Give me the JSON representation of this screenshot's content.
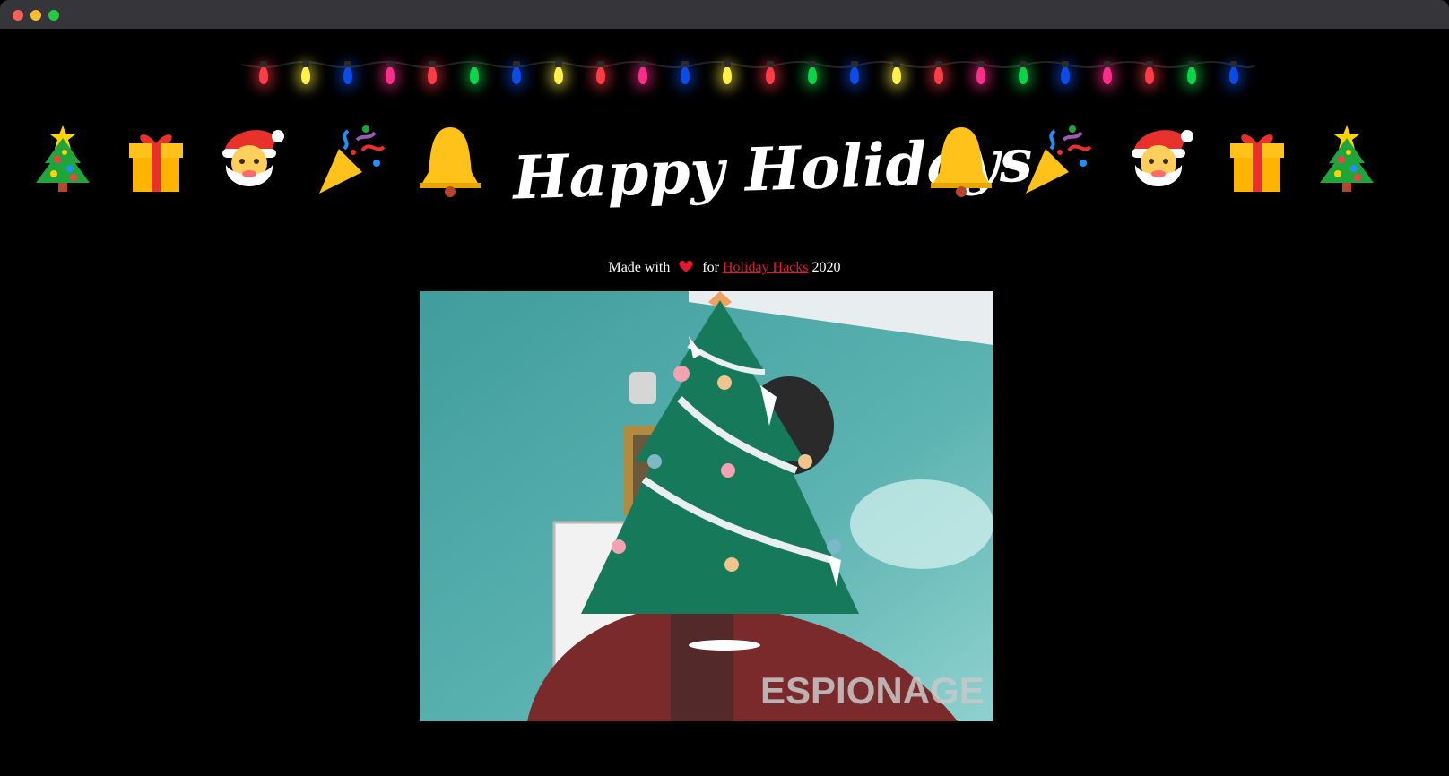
{
  "window": {
    "controls": [
      "close",
      "minimize",
      "maximize"
    ]
  },
  "lights": {
    "colors": [
      "#ff3b46",
      "#fff04a",
      "#0b4ce8",
      "#ff2d8a",
      "#ff3b46",
      "#0bd44a",
      "#0b4ce8",
      "#fff04a",
      "#ff3b46",
      "#ff2d8a",
      "#0b4ce8",
      "#fff04a",
      "#ff3b46",
      "#0bd44a",
      "#0b4ce8",
      "#fff04a",
      "#ff3b46",
      "#ff2d8a",
      "#0bd44a",
      "#0b4ce8",
      "#ff2d8a",
      "#ff3b46",
      "#0bd44a",
      "#0b4ce8"
    ]
  },
  "banner": {
    "left_emojis": [
      "christmas-tree-icon",
      "gift-icon",
      "santa-icon",
      "party-popper-icon",
      "bell-icon"
    ],
    "right_emojis": [
      "bell-icon",
      "party-popper-icon",
      "santa-icon",
      "gift-icon",
      "christmas-tree-icon"
    ],
    "title": "Happy Holidays"
  },
  "credit": {
    "prefix": "Made with",
    "heart_icon": "heart-icon",
    "middle": "for",
    "link": "Holiday Hacks",
    "suffix": "2020",
    "link_color": "#e3182f"
  },
  "webcam": {
    "overlay": "christmas-tree-icon",
    "background": "#5aa7a5"
  }
}
